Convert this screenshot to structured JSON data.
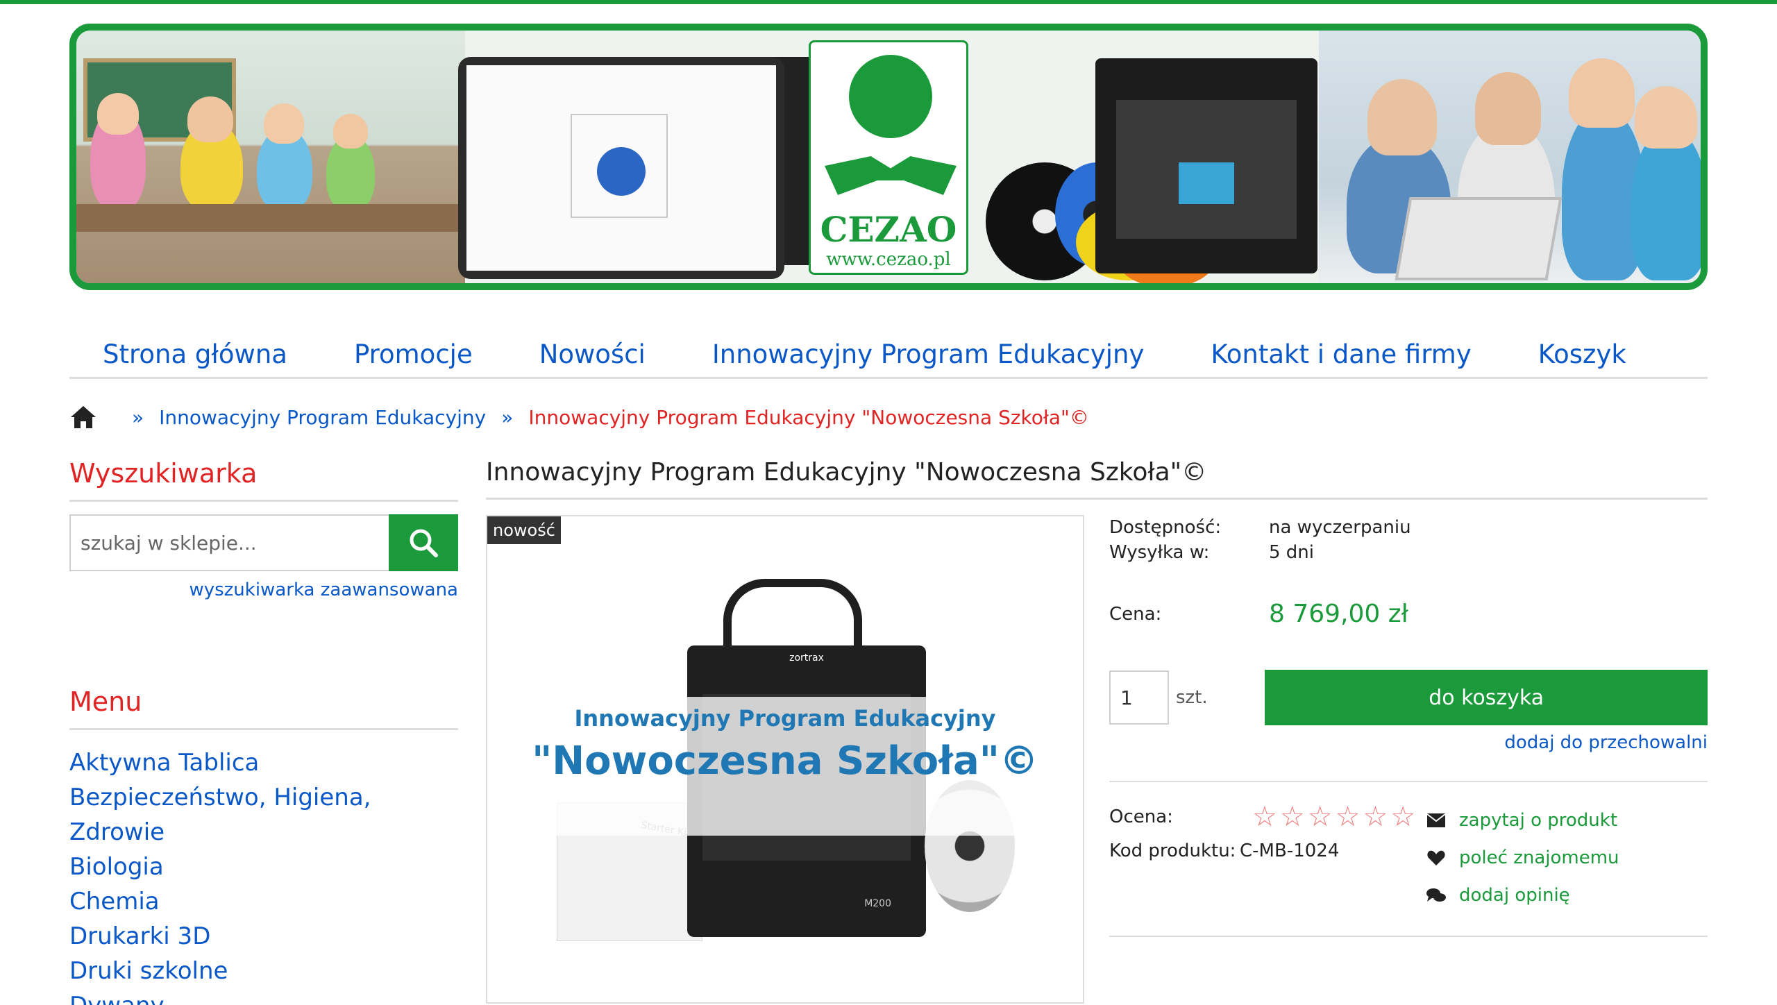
{
  "banner": {
    "logo_name": "CEZAO",
    "logo_url": "www.cezao.pl",
    "printer_brand": "zortrax"
  },
  "nav": {
    "items": [
      "Strona główna",
      "Promocje",
      "Nowości",
      "Innowacyjny Program Edukacyjny",
      "Kontakt i dane firmy",
      "Koszyk"
    ]
  },
  "breadcrumb": {
    "separator": "»",
    "link": "Innowacyjny Program Edukacyjny",
    "current": "Innowacyjny Program Edukacyjny \"Nowoczesna Szkoła\"©"
  },
  "sidebar": {
    "search_title": "Wyszukiwarka",
    "search_placeholder": "szukaj w sklepie...",
    "advanced_link": "wyszukiwarka zaawansowana",
    "menu_title": "Menu",
    "menu_items": [
      "Aktywna Tablica",
      "Bezpieczeństwo, Higiena,",
      "Zdrowie",
      "Biologia",
      "Chemia",
      "Drukarki 3D",
      "Druki szkolne",
      "Dywany"
    ]
  },
  "product": {
    "title": "Innowacyjny Program Edukacyjny \"Nowoczesna Szkoła\"©",
    "badge": "nowość",
    "image_line1": "Innowacyjny Program Edukacyjny",
    "image_line2": "\"Nowoczesna Szkoła\"©",
    "image_box_label": "Starter Kit",
    "image_model": "M200",
    "availability_label": "Dostępność:",
    "availability_value": "na wyczerpaniu",
    "shipping_label": "Wysyłka w:",
    "shipping_value": "5 dni",
    "price_label": "Cena:",
    "price_value": "8 769,00 zł",
    "quantity_value": "1",
    "quantity_unit": "szt.",
    "cart_button": "do koszyka",
    "storage_link": "dodaj do przechowalni",
    "rating_label": "Ocena:",
    "rating_stars": 6,
    "rating_value": 0,
    "code_label": "Kod produktu:",
    "code_value": "C-MB-1024",
    "actions": [
      "zapytaj o produkt",
      "poleć znajomemu",
      "dodaj opinię"
    ]
  },
  "colors": {
    "brand_green": "#1a9a3a",
    "link_blue": "#0a58c7",
    "accent_red": "#e12323"
  }
}
